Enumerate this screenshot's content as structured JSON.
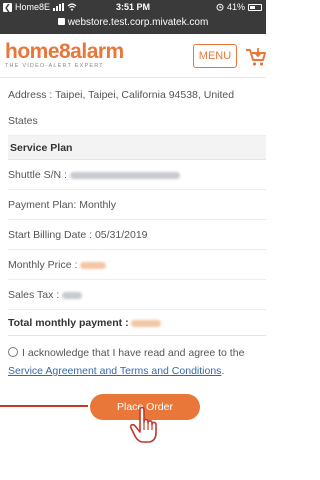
{
  "status_bar": {
    "carrier": "Home8E",
    "time": "3:51 PM",
    "battery": "41%"
  },
  "url_bar": {
    "url": "webstore.test.corp.mivatek.com"
  },
  "header": {
    "logo_text": "home8alarm",
    "tagline": "THE VIDEO-ALERT EXPERT",
    "menu_label": "MENU"
  },
  "order": {
    "address": "Address : Taipei, Taipei, California 94538, United States",
    "service_plan_heading": "Service Plan",
    "shuttle_sn_label": "Shuttle S/N :",
    "payment_plan": "Payment Plan: Monthly",
    "start_billing": "Start Billing Date : 05/31/2019",
    "monthly_price_label": "Monthly Price :",
    "sales_tax_label": "Sales Tax :",
    "total_label": "Total monthly payment :"
  },
  "agreement": {
    "text": "I acknowledge that I have read and agree to the",
    "link": "Service Agreement and Terms and Conditions",
    "suffix": "."
  },
  "actions": {
    "place_order": "Place Order"
  },
  "colors": {
    "brand_orange": "#e9773a",
    "link_blue": "#3569a8",
    "pointer_red": "#c0392b"
  },
  "icons": [
    "back-icon",
    "signal-icon",
    "wifi-icon",
    "lock-icon",
    "battery-icon",
    "cart-icon",
    "hand-cursor-icon"
  ]
}
